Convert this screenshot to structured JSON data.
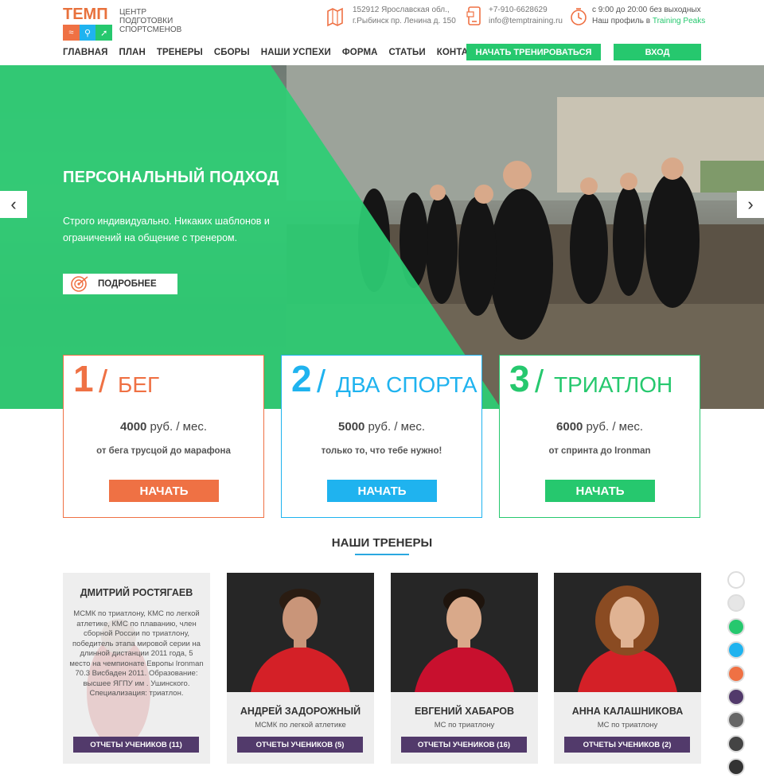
{
  "header": {
    "logo_word": "ТЕМП",
    "logo_text": "ЦЕНТР ПОДГОТОВКИ СПОРТСМЕНОВ",
    "address_line1": "152912 Ярославская обл.,",
    "address_line2": "г.Рыбинск пр. Ленина д. 150",
    "phone": "+7-910-6628629",
    "email": "info@temptraining.ru",
    "hours": "с 9:00 до 20:00 без выходных",
    "profile_prefix": "Наш профиль в ",
    "profile_link": "Training Peaks"
  },
  "nav": {
    "items": [
      "ГЛАВНАЯ",
      "ПЛАН",
      "ТРЕНЕРЫ",
      "СБОРЫ",
      "НАШИ УСПЕХИ",
      "ФОРМА",
      "СТАТЬИ",
      "КОНТАКТЫ"
    ],
    "start_button": "НАЧАТЬ ТРЕНИРОВАТЬСЯ",
    "login_button": "ВХОД"
  },
  "hero": {
    "title": "ПЕРСОНАЛЬНЫЙ ПОДХОД",
    "text": "Строго индивидуально. Никаких шаблонов и ограничений на общение с тренером.",
    "more_button": "ПОДРОБНЕЕ",
    "prev_arrow": "‹",
    "next_arrow": "›"
  },
  "plans": [
    {
      "num": "1",
      "name": "БЕГ",
      "price_value": "4000",
      "price_unit": " руб. / мес.",
      "desc": "от бега трусцой до марафона",
      "button": "НАЧАТЬ",
      "color": "#ef7144"
    },
    {
      "num": "2",
      "name": "ДВА СПОРТА",
      "price_value": "5000",
      "price_unit": " руб. / мес.",
      "desc": "только то, что тебе нужно!",
      "button": "НАЧАТЬ",
      "color": "#1fb3ef"
    },
    {
      "num": "3",
      "name": "ТРИАТЛОН",
      "price_value": "6000",
      "price_unit": " руб. / мес.",
      "desc": "от спринта до Ironman",
      "button": "НАЧАТЬ",
      "color": "#26c86e"
    }
  ],
  "trainers_section": {
    "title": "НАШИ ТРЕНЕРЫ",
    "featured": {
      "name": "ДМИТРИЙ РОСТЯГАЕВ",
      "bio": "МСМК по триатлону, КМС по легкой атлетике, КМС по плаванию, член сборной России по триатлону, победитель этапа мировой серии на длинной дистанции 2011 года, 5 место на чемпионате Европы Ironman 70.3 Висбаден 2011. Образование: высшее ЯГПУ им . Ушинского. Специализация: триатлон.",
      "button": "ОТЧЕТЫ УЧЕНИКОВ (11)"
    },
    "trainers": [
      {
        "name": "АНДРЕЙ ЗАДОРОЖНЫЙ",
        "title": "МСМК по легкой атлетике",
        "button": "ОТЧЕТЫ УЧЕНИКОВ (5)"
      },
      {
        "name": "ЕВГЕНИЙ ХАБАРОВ",
        "title": "МС по триатлону",
        "button": "ОТЧЕТЫ УЧЕНИКОВ (16)"
      },
      {
        "name": "АННА КАЛАШНИКОВА",
        "title": "МС по триатлону",
        "button": "ОТЧЕТЫ УЧЕНИКОВ (2)"
      }
    ]
  },
  "color_swatches": [
    "#ffffff",
    "#e6e6e6",
    "#26c86e",
    "#1fb3ef",
    "#ef7144",
    "#523a6b",
    "#666666",
    "#444444",
    "#333333"
  ],
  "colors": {
    "green": "#26c86e",
    "orange": "#ef7144",
    "blue": "#1fb3ef",
    "purple": "#523a6b"
  }
}
